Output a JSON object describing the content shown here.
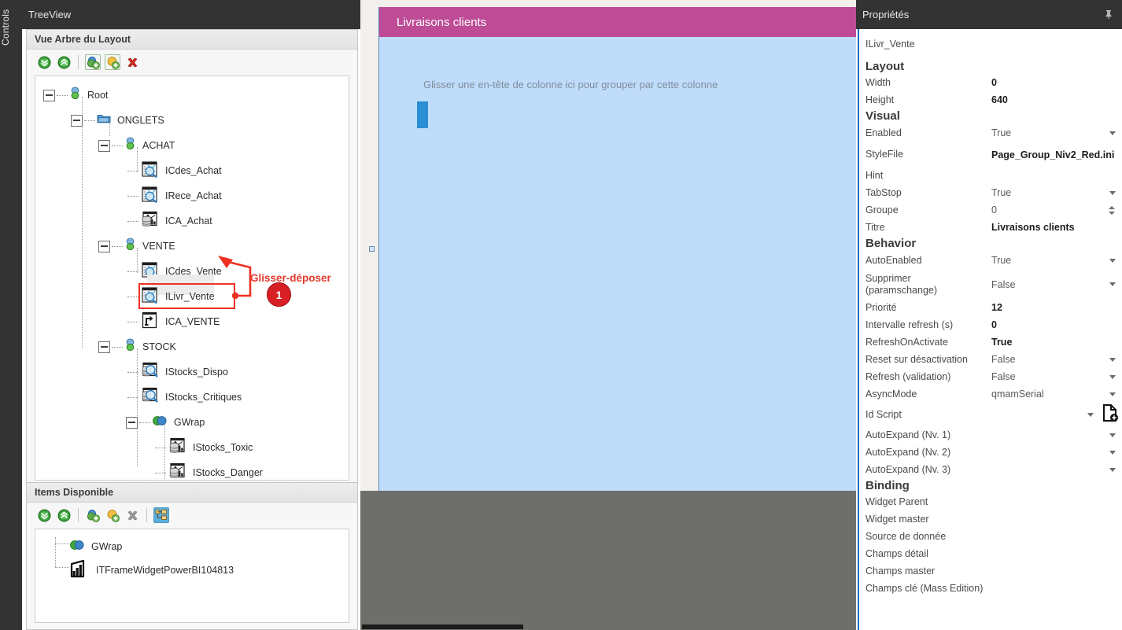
{
  "window": {
    "vertical_tab": "Controls"
  },
  "left_dock": {
    "title": "TreeView",
    "layout_panel": {
      "header": "Vue Arbre du Layout",
      "header_underline_char": "L",
      "toolbar": [
        {
          "name": "expand-all-icon",
          "tooltip": "Expand all"
        },
        {
          "name": "collapse-all-icon",
          "tooltip": "Collapse all"
        },
        {
          "name": "add-group-icon",
          "tooltip": "Add group"
        },
        {
          "name": "add-item-icon",
          "tooltip": "Add item"
        },
        {
          "name": "delete-icon",
          "tooltip": "Delete"
        }
      ],
      "tree": [
        {
          "label": "Root",
          "depth": 0,
          "icon": "node-green-icon",
          "expander": "minus"
        },
        {
          "label": "ONGLETS",
          "depth": 1,
          "icon": "folder-blue-icon",
          "expander": "minus"
        },
        {
          "label": "ACHAT",
          "depth": 2,
          "icon": "node-green-icon",
          "expander": "minus"
        },
        {
          "label": "ICdes_Achat",
          "depth": 3,
          "icon": "grid-search-icon",
          "expander": "none"
        },
        {
          "label": "IRece_Achat",
          "depth": 3,
          "icon": "grid-search-icon",
          "expander": "none"
        },
        {
          "label": "ICA_Achat",
          "depth": 3,
          "icon": "db-chart-icon",
          "expander": "none"
        },
        {
          "label": "VENTE",
          "depth": 2,
          "icon": "node-green-icon",
          "expander": "minus"
        },
        {
          "label": "ICdes_Vente",
          "depth": 3,
          "icon": "grid-search-icon",
          "expander": "none"
        },
        {
          "label": "ILivr_Vente",
          "depth": 3,
          "icon": "grid-search-icon",
          "expander": "none",
          "selected": true
        },
        {
          "label": "ICA_VENTE",
          "depth": 3,
          "icon": "arrow-box-icon",
          "expander": "none"
        },
        {
          "label": "STOCK",
          "depth": 2,
          "icon": "node-green-icon",
          "expander": "minus"
        },
        {
          "label": "IStocks_Dispo",
          "depth": 3,
          "icon": "db-search-icon",
          "expander": "none"
        },
        {
          "label": "IStocks_Critiques",
          "depth": 3,
          "icon": "db-search-icon",
          "expander": "none"
        },
        {
          "label": "GWrap",
          "depth": 3,
          "icon": "wrap-green-blue-icon",
          "expander": "minus"
        },
        {
          "label": "IStocks_Toxic",
          "depth": 4,
          "icon": "db-chart-icon",
          "expander": "none"
        },
        {
          "label": "IStocks_Danger",
          "depth": 4,
          "icon": "db-chart-icon",
          "expander": "none"
        }
      ]
    },
    "items_panel": {
      "header": "Items Disponible",
      "header_underline_char": "D",
      "toolbar": [
        {
          "name": "expand-all-icon"
        },
        {
          "name": "collapse-all-icon"
        },
        {
          "name": "add-group-icon"
        },
        {
          "name": "add-item-icon"
        },
        {
          "name": "delete-icon"
        },
        {
          "name": "tree-layout-icon",
          "active": true
        }
      ],
      "tree": [
        {
          "label": "GWrap",
          "depth": 0,
          "icon": "wrap-green-blue-icon"
        },
        {
          "label": "ITFrameWidgetPowerBI104813",
          "depth": 0,
          "icon": "powerbi-icon"
        }
      ]
    }
  },
  "annotations": [
    {
      "id": "1",
      "text": "Glisser-déposer"
    },
    {
      "id": "2",
      "text": ""
    }
  ],
  "center": {
    "widget_title": "Livraisons clients",
    "group_hint": "Glisser une en-tête de colonne ici pour grouper par cette colonne",
    "colors": {
      "header": "#bd4b96",
      "body": "#bfdcfb",
      "accent": "#2b8fd4"
    }
  },
  "right_dock": {
    "title": "Propriétés",
    "pin_icon": "pin-icon",
    "selected_object": "ILivr_Vente",
    "duplicate_icon": "copy-pages-icon",
    "rows": [
      {
        "kind": "object",
        "name": "ILivr_Vente"
      },
      {
        "kind": "section",
        "name": "Layout"
      },
      {
        "kind": "prop",
        "name": "Width",
        "value": "0",
        "bold": true,
        "control": "none"
      },
      {
        "kind": "prop",
        "name": "Height",
        "value": "640",
        "bold": true,
        "control": "none"
      },
      {
        "kind": "section",
        "name": "Visual"
      },
      {
        "kind": "prop",
        "name": "Enabled",
        "value": "True",
        "bold": false,
        "control": "dropdown"
      },
      {
        "kind": "prop",
        "name": "StyleFile",
        "value": "Page_Group_Niv2_Red.ini",
        "bold": true,
        "control": "none"
      },
      {
        "kind": "prop",
        "name": "Hint",
        "value": "",
        "bold": false,
        "control": "none"
      },
      {
        "kind": "prop",
        "name": "TabStop",
        "value": "True",
        "bold": false,
        "control": "dropdown"
      },
      {
        "kind": "prop",
        "name": "Groupe",
        "value": "0",
        "bold": false,
        "control": "spinner"
      },
      {
        "kind": "prop",
        "name": "Titre",
        "value": "Livraisons clients",
        "bold": true,
        "control": "none"
      },
      {
        "kind": "section",
        "name": "Behavior"
      },
      {
        "kind": "prop",
        "name": "AutoEnabled",
        "value": "True",
        "bold": false,
        "control": "dropdown"
      },
      {
        "kind": "prop",
        "name": "Supprimer (paramschange)",
        "name_line1": "Supprimer",
        "name_line2": "(paramschange)",
        "value": "False",
        "bold": false,
        "control": "dropdown",
        "twoline": true
      },
      {
        "kind": "prop",
        "name": "Priorité",
        "value": "12",
        "bold": true,
        "control": "none"
      },
      {
        "kind": "prop",
        "name": "Intervalle refresh (s)",
        "value": "0",
        "bold": true,
        "control": "none"
      },
      {
        "kind": "prop",
        "name": "RefreshOnActivate",
        "value": "True",
        "bold": true,
        "control": "none"
      },
      {
        "kind": "prop",
        "name": "Reset sur désactivation",
        "value": "False",
        "bold": false,
        "control": "dropdown"
      },
      {
        "kind": "prop",
        "name": "Refresh (validation)",
        "value": "False",
        "bold": false,
        "control": "dropdown"
      },
      {
        "kind": "prop",
        "name": "AsyncMode",
        "value": "qmamSerial",
        "bold": false,
        "control": "dropdown"
      },
      {
        "kind": "prop",
        "name": "Id Script",
        "value": "",
        "bold": false,
        "control": "dropdown-doc"
      },
      {
        "kind": "prop",
        "name": "AutoExpand (Nv. 1)",
        "value": "",
        "bold": false,
        "control": "dropdown"
      },
      {
        "kind": "prop",
        "name": "AutoExpand (Nv. 2)",
        "value": "",
        "bold": false,
        "control": "dropdown"
      },
      {
        "kind": "prop",
        "name": "AutoExpand (Nv. 3)",
        "value": "",
        "bold": false,
        "control": "dropdown"
      },
      {
        "kind": "section",
        "name": "Binding"
      },
      {
        "kind": "prop",
        "name": "Widget Parent",
        "value": "",
        "bold": false,
        "control": "none"
      },
      {
        "kind": "prop",
        "name": "Widget master",
        "value": "",
        "bold": false,
        "control": "none"
      },
      {
        "kind": "prop",
        "name": "Source de donnée",
        "value": "",
        "bold": false,
        "control": "none"
      },
      {
        "kind": "prop",
        "name": "Champs détail",
        "value": "",
        "bold": false,
        "control": "none"
      },
      {
        "kind": "prop",
        "name": "Champs master",
        "value": "",
        "bold": false,
        "control": "none"
      },
      {
        "kind": "prop",
        "name": "Champs clé (Mass Edition)",
        "value": "",
        "bold": false,
        "control": "none"
      }
    ]
  }
}
